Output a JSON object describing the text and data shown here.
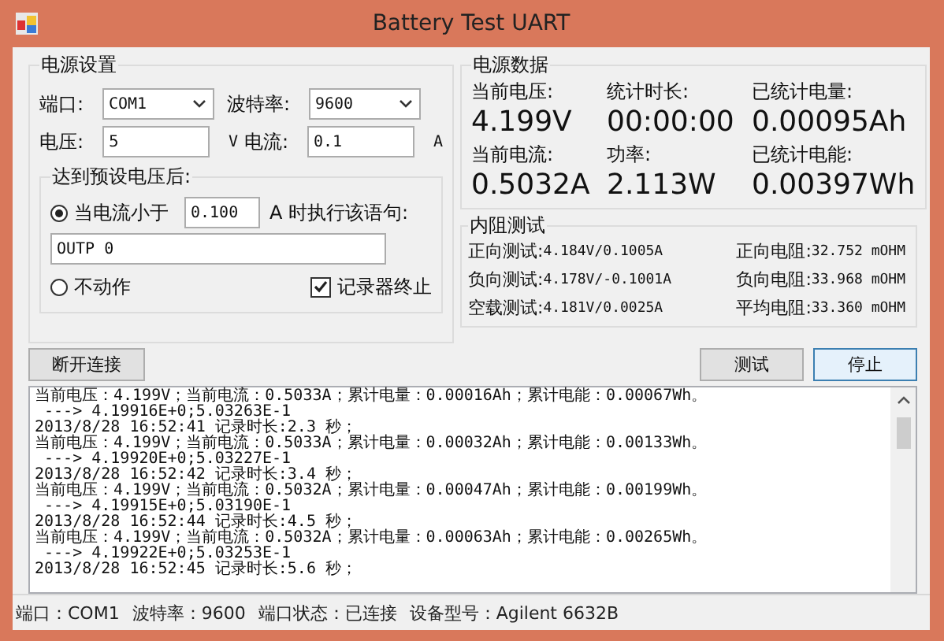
{
  "window": {
    "title": "Battery Test UART"
  },
  "power_settings": {
    "title": "电源设置",
    "port": {
      "label": "端口:",
      "value": "COM1"
    },
    "baud": {
      "label": "波特率:",
      "value": "9600"
    },
    "voltage": {
      "label": "电压:",
      "value": "5",
      "unit": "V"
    },
    "current": {
      "label": "电流:",
      "value": "0.1",
      "unit": "A"
    },
    "after_group": {
      "title": "达到预设电压后:",
      "options": [
        {
          "kind": "threshold",
          "label": "当电流小于",
          "value": "0.100",
          "suffix": "A 时执行该语句:",
          "selected": true
        },
        {
          "kind": "plain",
          "label": "不动作",
          "selected": false
        }
      ],
      "command": "OUTP 0",
      "recorder_stop": {
        "label": "记录器终止",
        "checked": true
      }
    }
  },
  "power_data": {
    "title": "电源数据",
    "readings": [
      {
        "label": "当前电压:",
        "value": "4.199V"
      },
      {
        "label": "统计时长:",
        "value": "00:00:00"
      },
      {
        "label": "已统计电量:",
        "value": "0.00095Ah"
      },
      {
        "label": "当前电流:",
        "value": "0.5032A"
      },
      {
        "label": "功率:",
        "value": "2.113W"
      },
      {
        "label": "已统计电能:",
        "value": "0.00397Wh"
      }
    ]
  },
  "resistance_test": {
    "title": "内阻测试",
    "rows": [
      {
        "label": "正向测试:",
        "value": "4.184V/0.1005A"
      },
      {
        "label": "正向电阻:",
        "value": "32.752 mOHM"
      },
      {
        "label": "负向测试:",
        "value": "4.178V/-0.1001A"
      },
      {
        "label": "负向电阻:",
        "value": "33.968 mOHM"
      },
      {
        "label": "空载测试:",
        "value": "4.181V/0.0025A"
      },
      {
        "label": "平均电阻:",
        "value": "33.360 mOHM"
      }
    ]
  },
  "buttons": {
    "disconnect": "断开连接",
    "test": "测试",
    "stop": "停止"
  },
  "log": {
    "lines": [
      "当前电压：4.199V；当前电流：0.5033A；累计电量：0.00016Ah；累计电能：0.00067Wh。",
      " ---> 4.19916E+0;5.03263E-1",
      "2013/8/28 16:52:41 记录时长:2.3 秒；",
      "当前电压：4.199V；当前电流：0.5033A；累计电量：0.00032Ah；累计电能：0.00133Wh。",
      " ---> 4.19920E+0;5.03227E-1",
      "2013/8/28 16:52:42 记录时长:3.4 秒；",
      "当前电压：4.199V；当前电流：0.5032A；累计电量：0.00047Ah；累计电能：0.00199Wh。",
      " ---> 4.19915E+0;5.03190E-1",
      "2013/8/28 16:52:44 记录时长:4.5 秒；",
      "当前电压：4.199V；当前电流：0.5032A；累计电量：0.00063Ah；累计电能：0.00265Wh。",
      " ---> 4.19922E+0;5.03253E-1",
      "2013/8/28 16:52:45 记录时长:5.6 秒；"
    ]
  },
  "status_bar": [
    "端口：COM1",
    "波特率：9600",
    "端口状态：已连接",
    "设备型号：Agilent 6632B"
  ]
}
